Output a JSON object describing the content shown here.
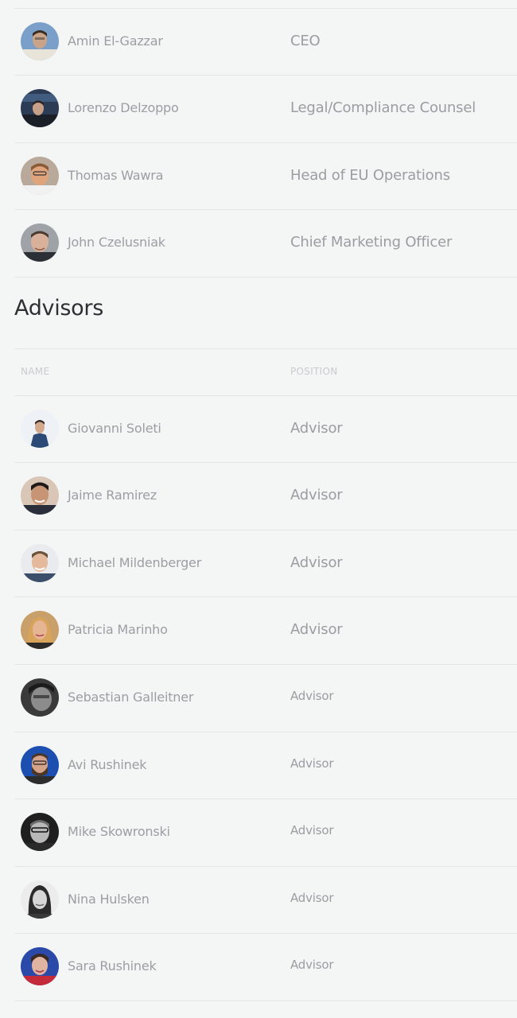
{
  "team": {
    "members": [
      {
        "name": "Amin El-Gazzar",
        "position": "CEO"
      },
      {
        "name": "Lorenzo Delzoppo",
        "position": "Legal/Compliance Counsel"
      },
      {
        "name": "Thomas Wawra",
        "position": "Head of EU Operations"
      },
      {
        "name": "John Czelusniak",
        "position": "Chief Marketing Officer"
      }
    ]
  },
  "advisors": {
    "title": "Advisors",
    "columns": {
      "name": "NAME",
      "position": "POSITION"
    },
    "members": [
      {
        "name": "Giovanni Soleti",
        "position": "Advisor"
      },
      {
        "name": "Jaime Ramirez",
        "position": "Advisor"
      },
      {
        "name": "Michael Mildenberger",
        "position": "Advisor"
      },
      {
        "name": "Patricia Marinho",
        "position": "Advisor"
      },
      {
        "name": "Sebastian Galleitner",
        "position": "Advisor"
      },
      {
        "name": "Avi Rushinek",
        "position": "Advisor"
      },
      {
        "name": "Mike Skowronski",
        "position": "Advisor"
      },
      {
        "name": "Nina Hulsken",
        "position": "Advisor"
      },
      {
        "name": "Sara Rushinek",
        "position": "Advisor"
      }
    ]
  },
  "avatar_colors": {
    "amin": {
      "bg": "#7a9fc8",
      "face": "#c9a488",
      "hair": "#3b2c22",
      "shirt": "#e8e4da"
    },
    "lorenzo": {
      "bg": "#2c3c55",
      "face": "#c7a08a",
      "hair": "#2a221c",
      "shirt": "#1b1f28"
    },
    "thomas": {
      "bg": "#b9a99a",
      "face": "#e0a47c",
      "hair": "#8a5a36",
      "shirt": "#f1f1f1"
    },
    "john": {
      "bg": "#9fa3a8",
      "face": "#d9b19a",
      "hair": "#4a3b2f",
      "shirt": "#2b2f36"
    },
    "giovanni": {
      "bg": "#eef2f6",
      "face": "#d2a98c",
      "hair": "#3a2d25",
      "shirt": "#2c4a78"
    },
    "jaime": {
      "bg": "#d9c6b6",
      "face": "#c79475",
      "hair": "#1f1a17",
      "shirt": "#2a2d3a"
    },
    "michael": {
      "bg": "#e9ebee",
      "face": "#e4b99c",
      "hair": "#6b5238",
      "shirt": "#3b4e6a"
    },
    "patricia": {
      "bg": "#caa06a",
      "face": "#e6b594",
      "hair": "#d8a35a",
      "shirt": "#2d2a2a"
    },
    "sebastian": {
      "bg": "#3a3a3a",
      "face": "#8c8c8c",
      "hair": "#1b1b1b",
      "shirt": "#2b2b2b"
    },
    "avi": {
      "bg": "#1d4fb0",
      "face": "#d4a38a",
      "hair": "#4a3626",
      "shirt": "#2c2c2c"
    },
    "mike": {
      "bg": "#1f1f1f",
      "face": "#b8b8b8",
      "hair": "#6b6b6b",
      "shirt": "#2a2a2a"
    },
    "nina": {
      "bg": "#ececec",
      "face": "#d6d6d6",
      "hair": "#2a2a2a",
      "shirt": "#3a3a3a"
    },
    "sara": {
      "bg": "#2a49a8",
      "face": "#e0b4a0",
      "hair": "#3a2a22",
      "shirt": "#c32a3a"
    }
  }
}
